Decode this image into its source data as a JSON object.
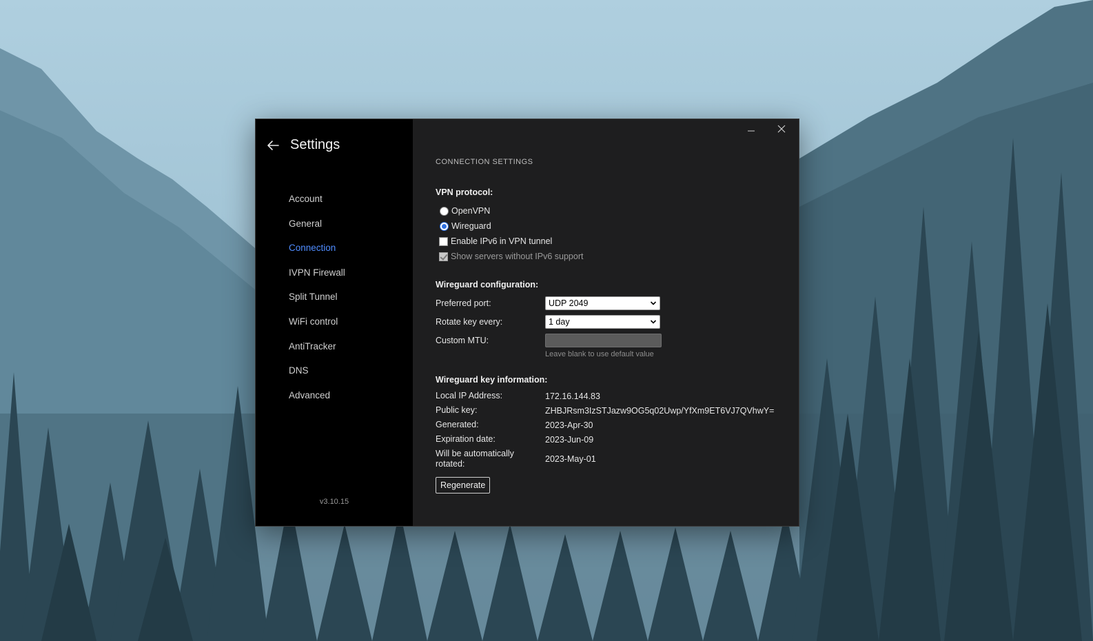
{
  "window": {
    "title": "Settings",
    "version": "v3.10.15"
  },
  "sidebar": {
    "items": [
      {
        "label": "Account"
      },
      {
        "label": "General"
      },
      {
        "label": "Connection"
      },
      {
        "label": "IVPN Firewall"
      },
      {
        "label": "Split Tunnel"
      },
      {
        "label": "WiFi control"
      },
      {
        "label": "AntiTracker"
      },
      {
        "label": "DNS"
      },
      {
        "label": "Advanced"
      }
    ],
    "active": "Connection",
    "accent_color": "#4f8cff"
  },
  "main": {
    "section_title": "CONNECTION SETTINGS",
    "vpn_protocol": {
      "title": "VPN protocol:",
      "options": [
        {
          "label": "OpenVPN",
          "selected": false
        },
        {
          "label": "Wireguard",
          "selected": true
        }
      ],
      "ipv6_tunnel": {
        "label": "Enable IPv6 in VPN tunnel",
        "checked": false
      },
      "show_no_ipv6": {
        "label": "Show servers without IPv6 support",
        "checked": true,
        "disabled": true
      }
    },
    "wireguard_config": {
      "title": "Wireguard configuration:",
      "preferred_port_label": "Preferred port:",
      "preferred_port_value": "UDP 2049",
      "rotate_key_label": "Rotate key every:",
      "rotate_key_value": "1 day",
      "custom_mtu_label": "Custom MTU:",
      "custom_mtu_value": "",
      "custom_mtu_hint": "Leave blank to use default value"
    },
    "wireguard_key": {
      "title": "Wireguard key information:",
      "local_ip_label": "Local IP Address:",
      "local_ip_value": "172.16.144.83",
      "public_key_label": "Public key:",
      "public_key_value": "ZHBJRsm3IzSTJazw9OG5q02Uwp/YfXm9ET6VJ7QVhwY=",
      "generated_label": "Generated:",
      "generated_value": "2023-Apr-30",
      "expiration_label": "Expiration date:",
      "expiration_value": "2023-Jun-09",
      "auto_rotate_label": "Will be automatically rotated:",
      "auto_rotate_value": "2023-May-01",
      "regenerate_label": "Regenerate"
    }
  }
}
